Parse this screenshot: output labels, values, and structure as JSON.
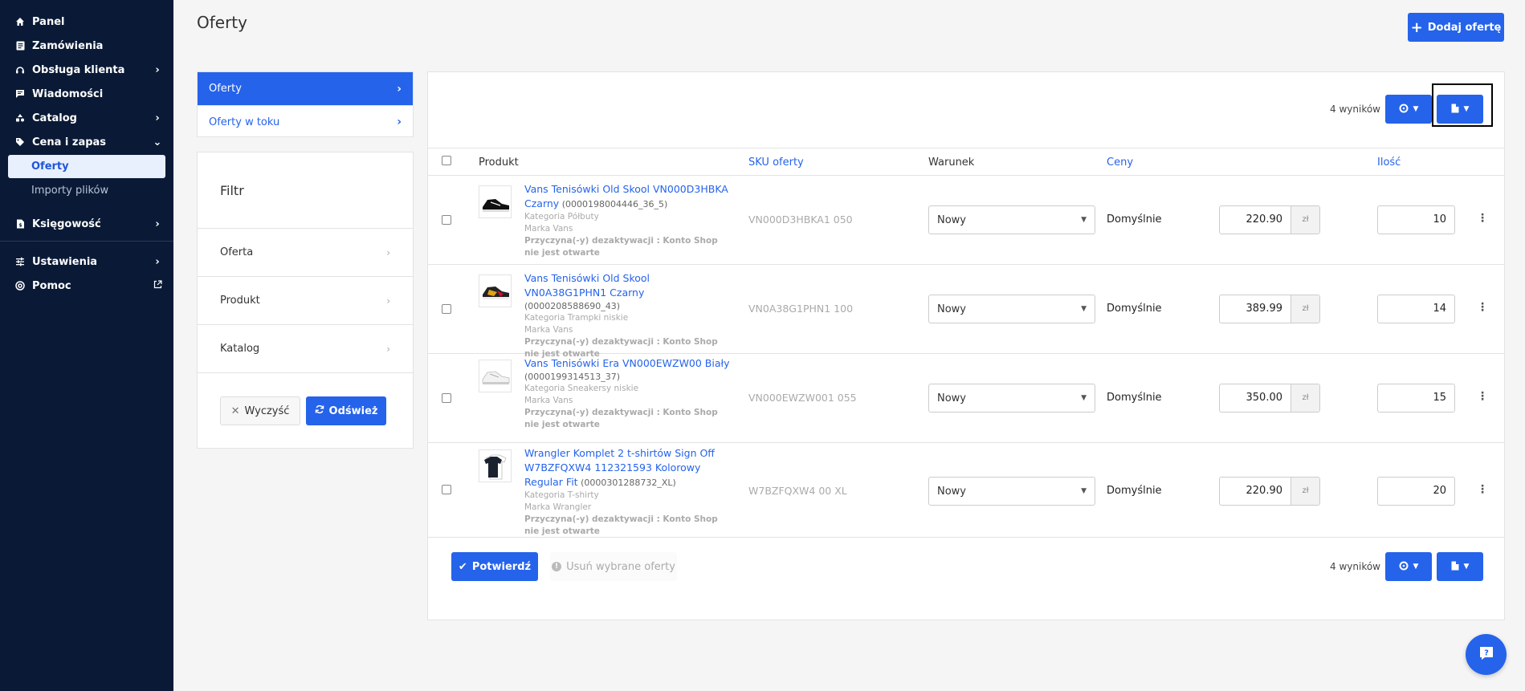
{
  "sidebar": {
    "items": [
      {
        "label": "Panel",
        "icon": "home-icon"
      },
      {
        "label": "Zamówienia",
        "icon": "orders-icon"
      },
      {
        "label": "Obsługa klienta",
        "icon": "headset-icon"
      },
      {
        "label": "Wiadomości",
        "icon": "message-icon"
      },
      {
        "label": "Catalog",
        "icon": "catalog-icon"
      },
      {
        "label": "Cena i zapas",
        "icon": "tag-icon"
      },
      {
        "label": "Oferty"
      },
      {
        "label": "Importy plików"
      },
      {
        "label": "Księgowość",
        "icon": "accounting-icon"
      },
      {
        "label": "Ustawienia",
        "icon": "settings-icon"
      },
      {
        "label": "Pomoc",
        "icon": "help-icon"
      }
    ]
  },
  "header": {
    "title": "Oferty",
    "add_label": "Dodaj ofertę"
  },
  "tabs": [
    {
      "label": "Oferty"
    },
    {
      "label": "Oferty w toku"
    }
  ],
  "filter": {
    "title": "Filtr",
    "rows": [
      {
        "label": "Oferta"
      },
      {
        "label": "Produkt"
      },
      {
        "label": "Katalog"
      }
    ],
    "clear_label": "Wyczyść",
    "refresh_label": "Odśwież"
  },
  "main": {
    "results_label": "4 wyników",
    "columns": {
      "product": "Produkt",
      "sku": "SKU oferty",
      "condition": "Warunek",
      "prices": "Ceny",
      "quantity": "Ilość"
    },
    "rows": [
      {
        "name": "Vans Tenisówki Old Skool VN000D3HBKA Czarny",
        "code": "(0000198004446_36_5)",
        "category": "Kategoria Półbuty",
        "brand": "Marka Vans",
        "reason": "Przyczyna(-y) dezaktywacji : Konto Shop nie jest otwarte",
        "sku": "VN000D3HBKA1 050",
        "condition": "Nowy",
        "price_type": "Domyślnie",
        "price": "220.90",
        "currency": "zł",
        "quantity": "10"
      },
      {
        "name": "Vans Tenisówki Old Skool VN0A38G1PHN1 Czarny",
        "code": "(0000208588690_43)",
        "category": "Kategoria Trampki niskie",
        "brand": "Marka Vans",
        "reason": "Przyczyna(-y) dezaktywacji : Konto Shop nie jest otwarte",
        "sku": "VN0A38G1PHN1 100",
        "condition": "Nowy",
        "price_type": "Domyślnie",
        "price": "389.99",
        "currency": "zł",
        "quantity": "14"
      },
      {
        "name": "Vans Tenisówki Era VN000EWZW00 Biały",
        "code": "(0000199314513_37)",
        "category": "Kategoria Sneakersy niskie",
        "brand": "Marka Vans",
        "reason": "Przyczyna(-y) dezaktywacji : Konto Shop nie jest otwarte",
        "sku": "VN000EWZW001 055",
        "condition": "Nowy",
        "price_type": "Domyślnie",
        "price": "350.00",
        "currency": "zł",
        "quantity": "15"
      },
      {
        "name": "Wrangler Komplet 2 t-shirtów Sign Off W7BZFQXW4 112321593 Kolorowy Regular Fit",
        "code": "(0000301288732_XL)",
        "category": "Kategoria T-shirty",
        "brand": "Marka Wrangler",
        "reason": "Przyczyna(-y) dezaktywacji : Konto Shop nie jest otwarte",
        "sku": "W7BZFQXW4 00 XL",
        "condition": "Nowy",
        "price_type": "Domyślnie",
        "price": "220.90",
        "currency": "zł",
        "quantity": "20"
      }
    ],
    "confirm_label": "Potwierdź",
    "delete_label": "Usuń wybrane oferty"
  },
  "colors": {
    "sidebar_bg": "#0a1a36",
    "accent": "#2563eb"
  }
}
